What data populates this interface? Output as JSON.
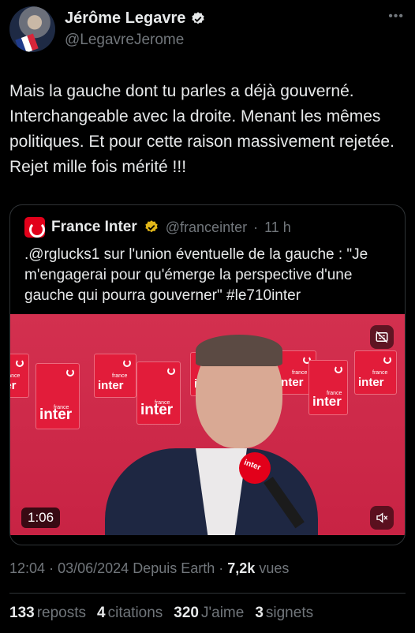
{
  "author": {
    "name": "Jérôme Legavre",
    "handle": "@LegavreJerome",
    "more_icon": "ellipsis-icon"
  },
  "tweet": {
    "text": "Mais la gauche dont tu parles a déjà gouverné. Interchangeable avec la droite. Menant les mêmes politiques. Et pour cette raison massivement rejetée. Rejet mille fois mérité !!!"
  },
  "quote": {
    "name": "France Inter",
    "handle": "@franceinter",
    "separator": "·",
    "time": "11 h",
    "text": ".@rglucks1 sur l'union éventuelle de la gauche : \"Je m'engagerai pour qu'émerge la perspective d'une gauche qui pourra gouverner\" #le710inter",
    "video": {
      "duration": "1:06",
      "brand_text": "inter",
      "brand_sub": "france",
      "mic_label": "inter"
    }
  },
  "meta": {
    "time": "12:04",
    "dot1": "·",
    "date": "03/06/2024",
    "source": "Depuis Earth",
    "dot2": "·",
    "views_count": "7,2k",
    "views_label": "vues"
  },
  "stats": {
    "reposts_count": "133",
    "reposts_label": "reposts",
    "quotes_count": "4",
    "quotes_label": "citations",
    "likes_count": "320",
    "likes_label": "J'aime",
    "bookmarks_count": "3",
    "bookmarks_label": "signets"
  },
  "colors": {
    "background": "#000000",
    "text": "#e7e9ea",
    "secondary": "#71767b",
    "verified_blue": "#1d9bf0",
    "verified_gold": "#e2b719",
    "france_inter_red": "#e2001a"
  }
}
